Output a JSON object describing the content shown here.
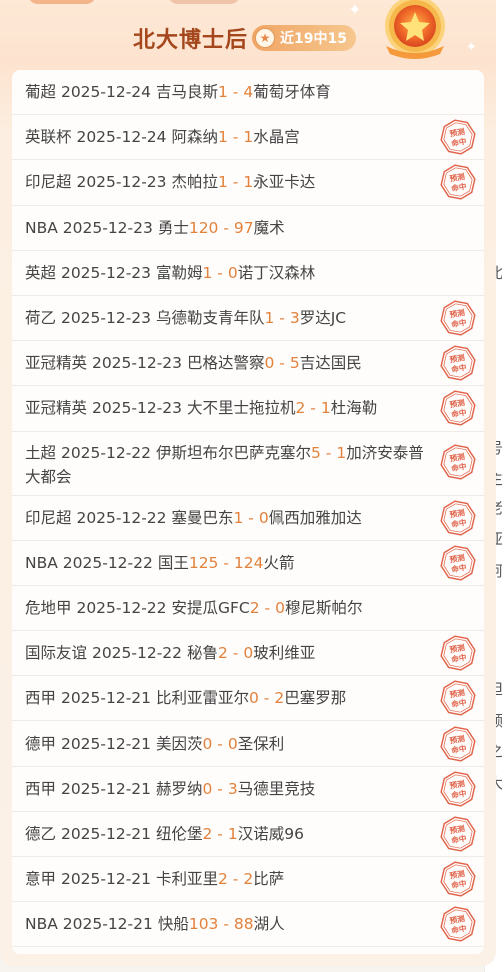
{
  "header": {
    "title": "北大博士后",
    "badge": "近19中15"
  },
  "stamp_text": [
    "预测",
    "命中"
  ],
  "matches": [
    {
      "league": "葡超",
      "date": "2025-12-24",
      "home": "吉马良斯",
      "score_home": "1",
      "score_away": "4",
      "away": "葡萄牙体育",
      "hit": false
    },
    {
      "league": "英联杯",
      "date": "2025-12-24",
      "home": "阿森纳",
      "score_home": "1",
      "score_away": "1",
      "away": "水晶宫",
      "hit": true
    },
    {
      "league": "印尼超",
      "date": "2025-12-23",
      "home": "杰帕拉",
      "score_home": "1",
      "score_away": "1",
      "away": "永亚卡达",
      "hit": true
    },
    {
      "league": "NBA",
      "date": "2025-12-23",
      "home": "勇士",
      "score_home": "120",
      "score_away": "97",
      "away": "魔术",
      "hit": false
    },
    {
      "league": "英超",
      "date": "2025-12-23",
      "home": "富勒姆",
      "score_home": "1",
      "score_away": "0",
      "away": "诺丁汉森林",
      "hit": false
    },
    {
      "league": "荷乙",
      "date": "2025-12-23",
      "home": "乌德勒支青年队",
      "score_home": "1",
      "score_away": "3",
      "away": "罗达JC",
      "hit": true
    },
    {
      "league": "亚冠精英",
      "date": "2025-12-23",
      "home": "巴格达警察",
      "score_home": "0",
      "score_away": "5",
      "away": "吉达国民",
      "hit": true
    },
    {
      "league": "亚冠精英",
      "date": "2025-12-23",
      "home": "大不里士拖拉机",
      "score_home": "2",
      "score_away": "1",
      "away": "杜海勒",
      "hit": true
    },
    {
      "league": "土超",
      "date": "2025-12-22",
      "home": "伊斯坦布尔巴萨克塞尔",
      "score_home": "5",
      "score_away": "1",
      "away": "加济安泰普大都会",
      "hit": true,
      "tall": true
    },
    {
      "league": "印尼超",
      "date": "2025-12-22",
      "home": "塞曼巴东",
      "score_home": "1",
      "score_away": "0",
      "away": "佩西加雅加达",
      "hit": true
    },
    {
      "league": "NBA",
      "date": "2025-12-22",
      "home": "国王",
      "score_home": "125",
      "score_away": "124",
      "away": "火箭",
      "hit": true
    },
    {
      "league": "危地甲",
      "date": "2025-12-22",
      "home": "安提瓜GFC",
      "score_home": "2",
      "score_away": "0",
      "away": "穆尼斯帕尔",
      "hit": false
    },
    {
      "league": "国际友谊",
      "date": "2025-12-22",
      "home": "秘鲁",
      "score_home": "2",
      "score_away": "0",
      "away": "玻利维亚",
      "hit": true
    },
    {
      "league": "西甲",
      "date": "2025-12-21",
      "home": "比利亚雷亚尔",
      "score_home": "0",
      "score_away": "2",
      "away": "巴塞罗那",
      "hit": true
    },
    {
      "league": "德甲",
      "date": "2025-12-21",
      "home": "美因茨",
      "score_home": "0",
      "score_away": "0",
      "away": "圣保利",
      "hit": true
    },
    {
      "league": "西甲",
      "date": "2025-12-21",
      "home": "赫罗纳",
      "score_home": "0",
      "score_away": "3",
      "away": "马德里竞技",
      "hit": true
    },
    {
      "league": "德乙",
      "date": "2025-12-21",
      "home": "纽伦堡",
      "score_home": "2",
      "score_away": "1",
      "away": "汉诺威96",
      "hit": true
    },
    {
      "league": "意甲",
      "date": "2025-12-21",
      "home": "卡利亚里",
      "score_home": "2",
      "score_away": "2",
      "away": "比萨",
      "hit": true
    },
    {
      "league": "NBA",
      "date": "2025-12-21",
      "home": "快船",
      "score_home": "103",
      "score_away": "88",
      "away": "湖人",
      "hit": true
    }
  ],
  "background_page": {
    "fragments": [
      "[",
      "北",
      "号",
      "主",
      "老",
      "亚",
      "阿",
      "但",
      "领",
      "之",
      "大"
    ]
  },
  "colors": {
    "title": "#a5471d",
    "score": "#e2823d",
    "stamp": "#e0634a"
  }
}
